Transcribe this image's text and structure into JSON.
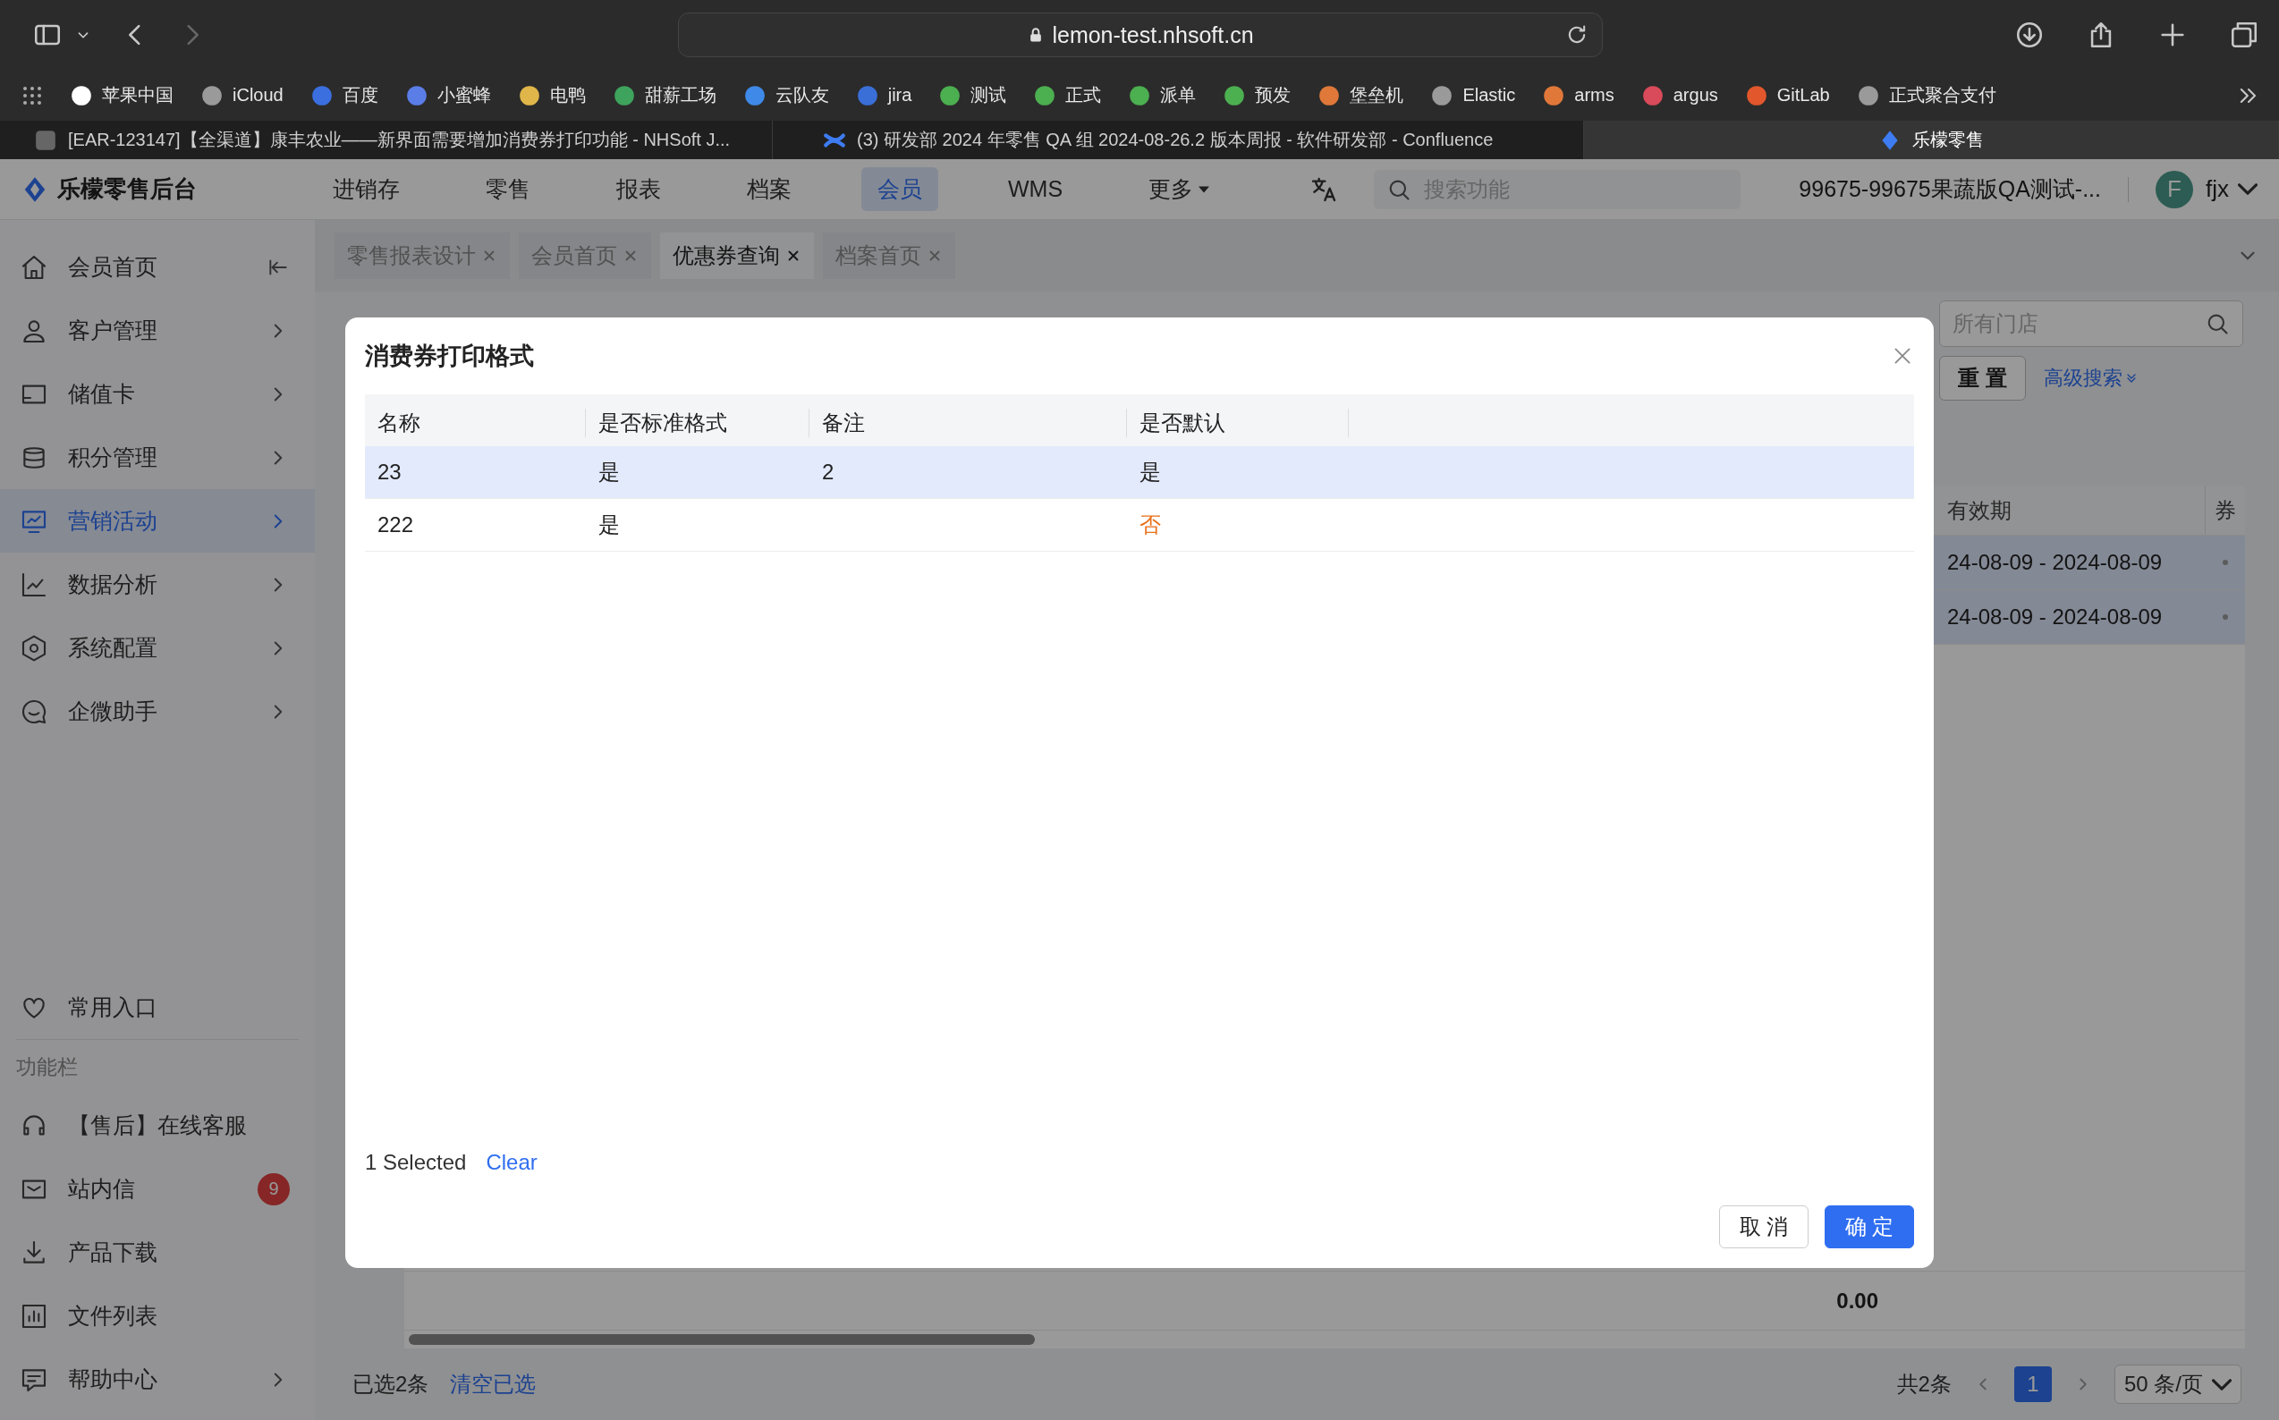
{
  "browser": {
    "url": "lemon-test.nhsoft.cn",
    "bookmarks": [
      {
        "label": "苹果中国"
      },
      {
        "label": "iCloud"
      },
      {
        "label": "百度"
      },
      {
        "label": "小蜜蜂"
      },
      {
        "label": "电鸭"
      },
      {
        "label": "甜薪工场"
      },
      {
        "label": "云队友"
      },
      {
        "label": "jira"
      },
      {
        "label": "测试"
      },
      {
        "label": "正式"
      },
      {
        "label": "派单"
      },
      {
        "label": "预发"
      },
      {
        "label": "堡垒机"
      },
      {
        "label": "Elastic"
      },
      {
        "label": "arms"
      },
      {
        "label": "argus"
      },
      {
        "label": "GitLab"
      },
      {
        "label": "正式聚合支付"
      }
    ],
    "tabs": [
      {
        "title": "[EAR-123147]【全渠道】康丰农业——新界面需要增加消费券打印功能 - NHSoft J...",
        "selected": false
      },
      {
        "title": "(3) 研发部 2024 年零售 QA 组 2024-08-26.2 版本周报 - 软件研发部 - Confluence",
        "selected": false
      },
      {
        "title": "乐檬零售",
        "selected": true
      }
    ]
  },
  "header": {
    "logo": "乐檬零售后台",
    "nav": [
      {
        "label": "进销存",
        "selected": false
      },
      {
        "label": "零售",
        "selected": false
      },
      {
        "label": "报表",
        "selected": false
      },
      {
        "label": "档案",
        "selected": false
      },
      {
        "label": "会员",
        "selected": true
      },
      {
        "label": "WMS",
        "selected": false
      }
    ],
    "more": "更多",
    "search_placeholder": "搜索功能",
    "store": "99675-99675果蔬版QA测试-...",
    "user": {
      "initial": "F",
      "name": "fjx"
    }
  },
  "sidebar": {
    "items": [
      {
        "label": "会员首页",
        "kind": "collapse",
        "selected": false
      },
      {
        "label": "客户管理",
        "kind": "submenu",
        "selected": false
      },
      {
        "label": "储值卡",
        "kind": "submenu",
        "selected": false
      },
      {
        "label": "积分管理",
        "kind": "submenu",
        "selected": false
      },
      {
        "label": "营销活动",
        "kind": "submenu",
        "selected": true
      },
      {
        "label": "数据分析",
        "kind": "submenu",
        "selected": false
      },
      {
        "label": "系统配置",
        "kind": "submenu",
        "selected": false
      },
      {
        "label": "企微助手",
        "kind": "submenu",
        "selected": false
      }
    ],
    "favorites": "常用入口",
    "section_title": "功能栏",
    "tools": [
      {
        "label": "【售后】在线客服",
        "kind": "plain"
      },
      {
        "label": "站内信",
        "kind": "badge",
        "badge": "9"
      },
      {
        "label": "产品下载",
        "kind": "plain"
      },
      {
        "label": "文件列表",
        "kind": "plain"
      },
      {
        "label": "帮助中心",
        "kind": "submenu"
      }
    ]
  },
  "content_tabs": [
    {
      "label": "零售报表设计",
      "selected": false
    },
    {
      "label": "会员首页",
      "selected": false
    },
    {
      "label": "优惠券查询",
      "selected": true
    },
    {
      "label": "档案首页",
      "selected": false
    }
  ],
  "filters": {
    "store_placeholder": "所有门店",
    "reset": "重 置",
    "advanced": "高级搜索"
  },
  "results_table": {
    "columns": [
      "有效期",
      "券"
    ],
    "rows": [
      {
        "validity": "24-08-09 - 2024-08-09",
        "selected": true
      },
      {
        "validity": "24-08-09 - 2024-08-09",
        "selected": true
      }
    ],
    "total": "0.00"
  },
  "footer": {
    "selected_count": "已选2条",
    "clear": "清空已选",
    "total": "共2条",
    "pages": [
      {
        "label": "1",
        "selected": true
      }
    ],
    "page_size": "50 条/页"
  },
  "dialog": {
    "title": "消费券打印格式",
    "columns": [
      "名称",
      "是否标准格式",
      "备注",
      "是否默认"
    ],
    "rows": [
      {
        "name": "23",
        "standard": "是",
        "remark": "2",
        "default": "是",
        "is_default": true,
        "selected": true
      },
      {
        "name": "222",
        "standard": "是",
        "default": "否",
        "is_default": false,
        "selected": false
      }
    ],
    "selection": "1 Selected",
    "clear": "Clear",
    "buttons": [
      {
        "label": "取 消",
        "kind": "default"
      },
      {
        "label": "确 定",
        "kind": "primary"
      }
    ]
  }
}
